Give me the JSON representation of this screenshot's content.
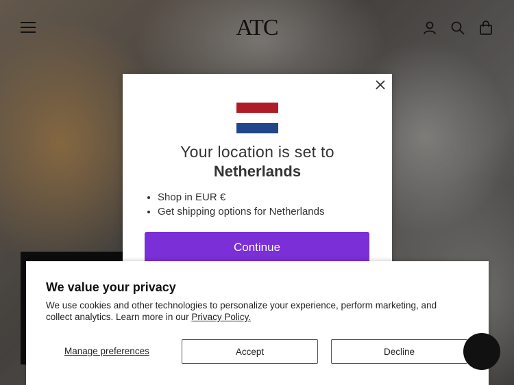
{
  "header": {
    "logo": "ATC",
    "icons": [
      "menu-icon",
      "account-icon",
      "search-icon",
      "cart-icon"
    ]
  },
  "location_modal": {
    "line1": "Your location is set to",
    "country": "Netherlands",
    "bullets": [
      "Shop in EUR €",
      "Get shipping options for Netherlands"
    ],
    "continue_label": "Continue",
    "flag_colors": [
      "#ae1c28",
      "#ffffff",
      "#21468b"
    ],
    "accent": "#7b2fd6"
  },
  "cookie_banner": {
    "title": "We value your privacy",
    "body": "We use cookies and other technologies to personalize your experience, perform marketing, and collect analytics. Learn more in our ",
    "policy_link": "Privacy Policy.",
    "manage_label": "Manage preferences",
    "accept_label": "Accept",
    "decline_label": "Decline"
  }
}
